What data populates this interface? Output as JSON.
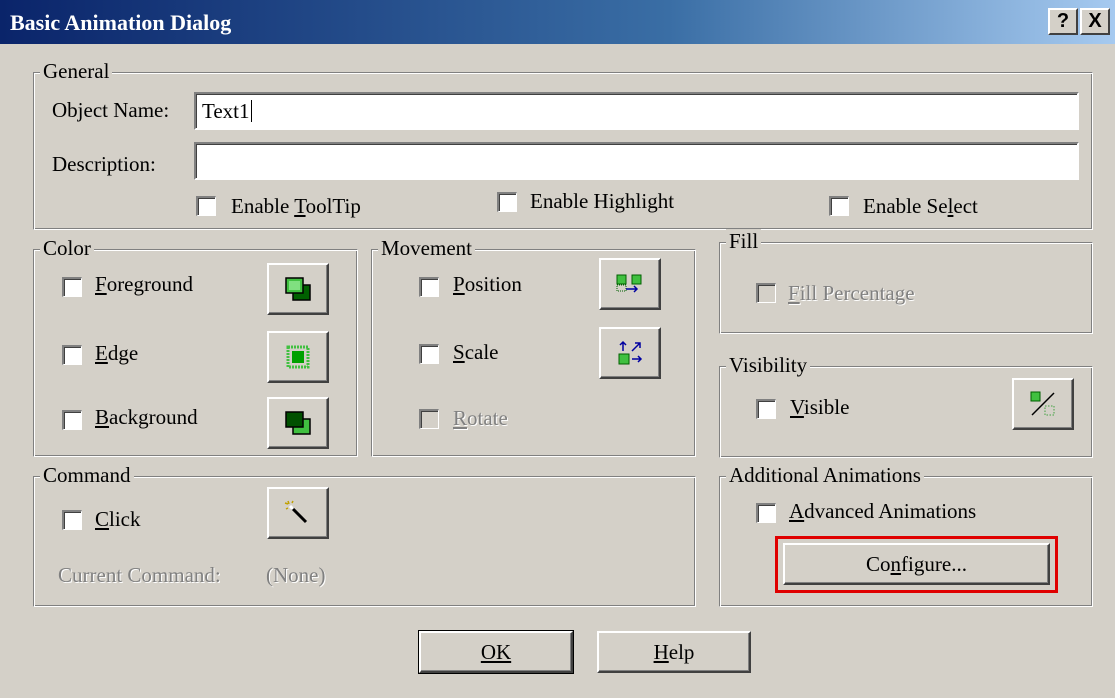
{
  "window": {
    "title": "Basic Animation Dialog",
    "help_button": "?",
    "close_button": "X"
  },
  "general": {
    "legend": "General",
    "object_name_label": "Object Name:",
    "object_name_value": "Text1",
    "description_label": "Description:",
    "description_value": "",
    "enable_tooltip": "Enable ToolTip",
    "enable_highlight": "Enable Highlight",
    "enable_select": "Enable Select"
  },
  "color": {
    "legend": "Color",
    "foreground": "Foreground",
    "edge": "Edge",
    "background": "Background"
  },
  "movement": {
    "legend": "Movement",
    "position": "Position",
    "scale": "Scale",
    "rotate": "Rotate"
  },
  "fill": {
    "legend": "Fill",
    "fill_percentage": "Fill Percentage"
  },
  "visibility": {
    "legend": "Visibility",
    "visible": "Visible"
  },
  "command": {
    "legend": "Command",
    "click": "Click",
    "current_command_label": "Current Command:",
    "current_command_value": "(None)"
  },
  "additional": {
    "legend": "Additional Animations",
    "advanced": "Advanced Animations",
    "configure": "Configure..."
  },
  "footer": {
    "ok": "OK",
    "help": "Help"
  },
  "colors": {
    "titlebar_start": "#0a246a",
    "titlebar_end": "#a6caf0",
    "dialog_bg": "#d4d0c8",
    "highlight_box": "#e00000",
    "icon_green": "#00a000"
  }
}
